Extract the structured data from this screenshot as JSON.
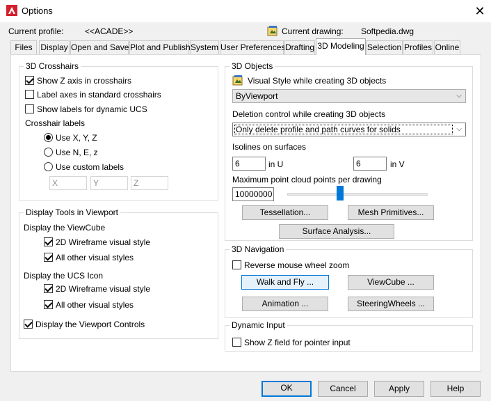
{
  "window": {
    "title": "Options",
    "close_glyph": "✕"
  },
  "profile": {
    "current_profile_label": "Current profile:",
    "current_profile_value": "<<ACADE>>",
    "current_drawing_label": "Current drawing:",
    "current_drawing_value": "Softpedia.dwg"
  },
  "tabs": [
    {
      "label": "Files"
    },
    {
      "label": "Display"
    },
    {
      "label": "Open and Save"
    },
    {
      "label": "Plot and Publish"
    },
    {
      "label": "System"
    },
    {
      "label": "User Preferences"
    },
    {
      "label": "Drafting"
    },
    {
      "label": "3D Modeling",
      "active": true
    },
    {
      "label": "Selection"
    },
    {
      "label": "Profiles"
    },
    {
      "label": "Online"
    }
  ],
  "crosshairs": {
    "title": "3D Crosshairs",
    "show_z_axis": {
      "label": "Show Z axis in crosshairs",
      "checked": true
    },
    "label_axes": {
      "label": "Label axes in standard crosshairs",
      "checked": false
    },
    "show_labels_ucs": {
      "label": "Show labels for dynamic UCS",
      "checked": false
    },
    "crosshair_labels_title": "Crosshair labels",
    "use_xyz": {
      "label": "Use X, Y, Z",
      "checked": true
    },
    "use_nez": {
      "label": "Use N, E, z",
      "checked": false
    },
    "use_custom": {
      "label": "Use custom labels",
      "checked": false
    },
    "custom_x": "X",
    "custom_y": "Y",
    "custom_z": "Z"
  },
  "display_tools": {
    "title": "Display Tools in Viewport",
    "viewcube_title": "Display the ViewCube",
    "viewcube_2d": {
      "label": "2D Wireframe visual style",
      "checked": true
    },
    "viewcube_all": {
      "label": "All other visual styles",
      "checked": true
    },
    "ucs_title": "Display the UCS Icon",
    "ucs_2d": {
      "label": "2D Wireframe visual style",
      "checked": true
    },
    "ucs_all": {
      "label": "All other visual styles",
      "checked": true
    },
    "viewport_controls": {
      "label": "Display the Viewport Controls",
      "checked": true
    }
  },
  "objects_3d": {
    "title": "3D Objects",
    "visual_style_label": "Visual Style while creating 3D objects",
    "visual_style_value": "ByViewport",
    "deletion_label": "Deletion control while creating 3D objects",
    "deletion_value": "Only delete profile and path curves for solids",
    "isolines_label": "Isolines on surfaces",
    "isolines_u": "6",
    "in_u": "in U",
    "isolines_v": "6",
    "in_v": "in V",
    "point_cloud_label": "Maximum point cloud points per drawing",
    "point_cloud_value": "10000000",
    "point_cloud_slider_fraction": 0.37,
    "tessellation_btn": "Tessellation...",
    "mesh_primitives_btn": "Mesh Primitives...",
    "surface_analysis_btn": "Surface Analysis..."
  },
  "navigation_3d": {
    "title": "3D Navigation",
    "reverse_wheel": {
      "label": "Reverse mouse wheel zoom",
      "checked": false
    },
    "walk_fly_btn": "Walk and Fly ...",
    "viewcube_btn": "ViewCube ...",
    "animation_btn": "Animation ...",
    "steering_btn": "SteeringWheels ..."
  },
  "dynamic_input": {
    "title": "Dynamic Input",
    "show_z": {
      "label": "Show Z field for pointer input",
      "checked": false
    }
  },
  "footer": {
    "ok": "OK",
    "cancel": "Cancel",
    "apply": "Apply",
    "help": "Help"
  },
  "colors": {
    "accent": "#0078d7",
    "app_icon": "#d4202c"
  }
}
